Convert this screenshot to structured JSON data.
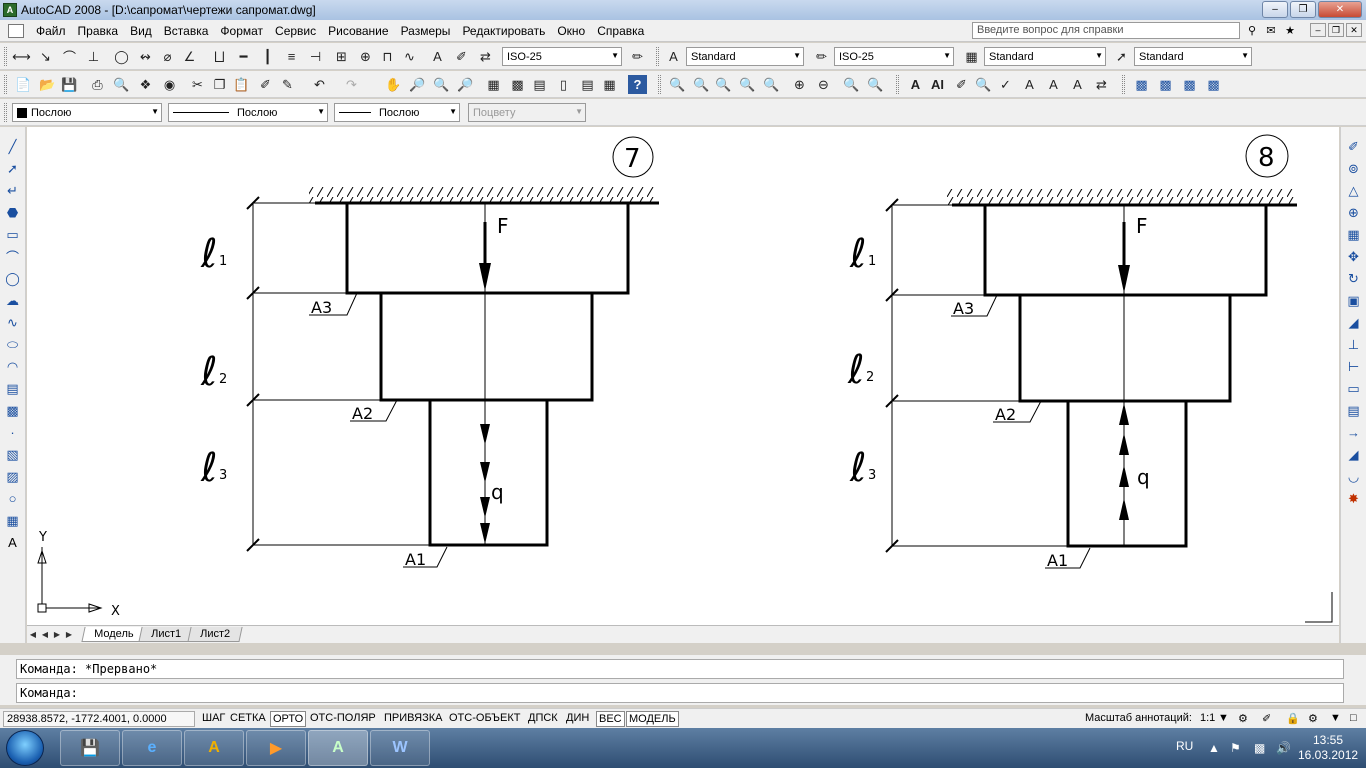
{
  "window": {
    "title": "AutoCAD 2008 - [D:\\сапромат\\чертежи сапромат.dwg]",
    "app_icon_text": "A"
  },
  "menu": {
    "items": [
      "Файл",
      "Правка",
      "Вид",
      "Вставка",
      "Формат",
      "Сервис",
      "Рисование",
      "Размеры",
      "Редактировать",
      "Окно",
      "Справка"
    ],
    "help_placeholder": "Введите вопрос для справки"
  },
  "toolbar": {
    "dim_style": "ISO-25",
    "text_style": "Standard",
    "dim_style2": "ISO-25",
    "table_style": "Standard",
    "multileader_style": "Standard",
    "layer_color": "Послою",
    "linetype": "Послою",
    "lineweight": "Послою",
    "plot_style": "Поцвету"
  },
  "drawing": {
    "fig7": {
      "number": "7",
      "labels": {
        "l1": "1",
        "l2": "2",
        "l3": "3",
        "A3": "A3",
        "A2": "A2",
        "A1": "A1",
        "F": "F",
        "q": "q"
      }
    },
    "fig8": {
      "number": "8",
      "labels": {
        "l1": "1",
        "l2": "2",
        "l3": "3",
        "A3": "A3",
        "A2": "A2",
        "A1": "A1",
        "F": "F",
        "q": "q"
      }
    },
    "ucs": {
      "x": "X",
      "y": "Y"
    }
  },
  "layout_tabs": [
    "Модель",
    "Лист1",
    "Лист2"
  ],
  "command": {
    "history": "Команда: *Прервано*",
    "prompt": "Команда:"
  },
  "status": {
    "coords": "28938.8572, -1772.4001, 0.0000",
    "buttons": [
      "ШАГ",
      "СЕТКА",
      "ОРТО",
      "ОТС-ПОЛЯР",
      "ПРИВЯЗКА",
      "ОТС-ОБЪЕКТ",
      "ДПСК",
      "ДИН",
      "ВЕС",
      "МОДЕЛЬ"
    ],
    "annotation_scale_label": "Масштаб аннотаций:",
    "annotation_scale": "1:1"
  },
  "taskbar": {
    "lang": "RU",
    "time": "13:55",
    "date": "16.03.2012"
  }
}
